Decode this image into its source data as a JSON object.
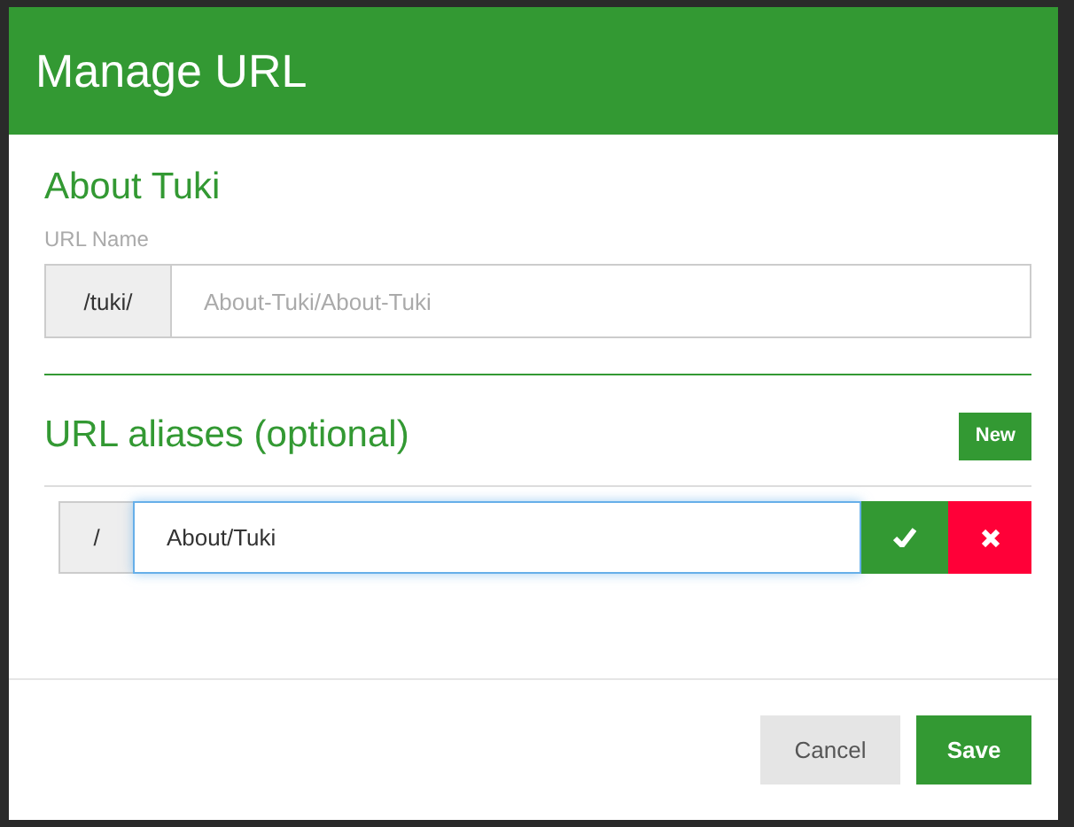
{
  "dialog": {
    "title": "Manage URL"
  },
  "page": {
    "title": "About Tuki",
    "url_label": "URL Name",
    "url_prefix": "/tuki/",
    "url_placeholder": "About-Tuki/About-Tuki"
  },
  "aliases": {
    "title": "URL aliases (optional)",
    "new_button": "New",
    "items": [
      {
        "prefix": "/",
        "value": "About/Tuki",
        "focused": true
      }
    ]
  },
  "buttons": [
    {
      "label": "Cancel",
      "kind": "secondary"
    },
    {
      "label": "Save",
      "kind": "primary"
    }
  ]
}
